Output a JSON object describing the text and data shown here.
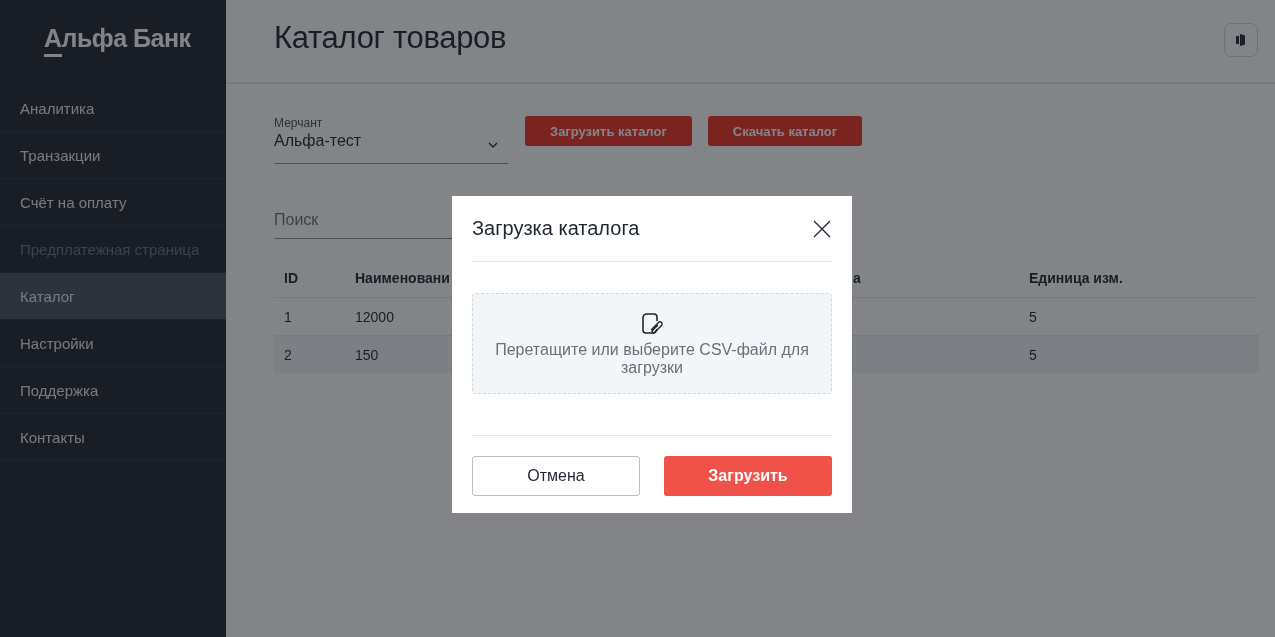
{
  "sidebar": {
    "logo": "Альфа Банк",
    "items": [
      {
        "label": "Аналитика",
        "selected": false,
        "disabled": false
      },
      {
        "label": "Транзакции",
        "selected": false,
        "disabled": false
      },
      {
        "label": "Счёт на оплату",
        "selected": false,
        "disabled": false
      },
      {
        "label": "Предплатежная страница",
        "selected": false,
        "disabled": true
      },
      {
        "label": "Каталог",
        "selected": true,
        "disabled": false
      },
      {
        "label": "Настройки",
        "selected": false,
        "disabled": false
      },
      {
        "label": "Поддержка",
        "selected": false,
        "disabled": false
      },
      {
        "label": "Контакты",
        "selected": false,
        "disabled": false
      }
    ]
  },
  "header": {
    "title": "Каталог товаров"
  },
  "merchant": {
    "label": "Мерчант",
    "value": "Альфа-тест"
  },
  "buttons": [
    "Загрузить каталог",
    "Скачать каталог"
  ],
  "search": {
    "placeholder": "Поиск"
  },
  "table": {
    "columns": [
      "ID",
      "Наименовани",
      "а",
      "Единица изм."
    ],
    "rows": [
      {
        "id": "1",
        "name": "12000",
        "unit": "5"
      },
      {
        "id": "2",
        "name": "150",
        "unit": "5"
      }
    ]
  },
  "dialog": {
    "title": "Загрузка каталога",
    "dropzone": "Перетащите или выберите CSV-файл для загрузки",
    "cancel": "Отмена",
    "submit": "Загрузить"
  }
}
